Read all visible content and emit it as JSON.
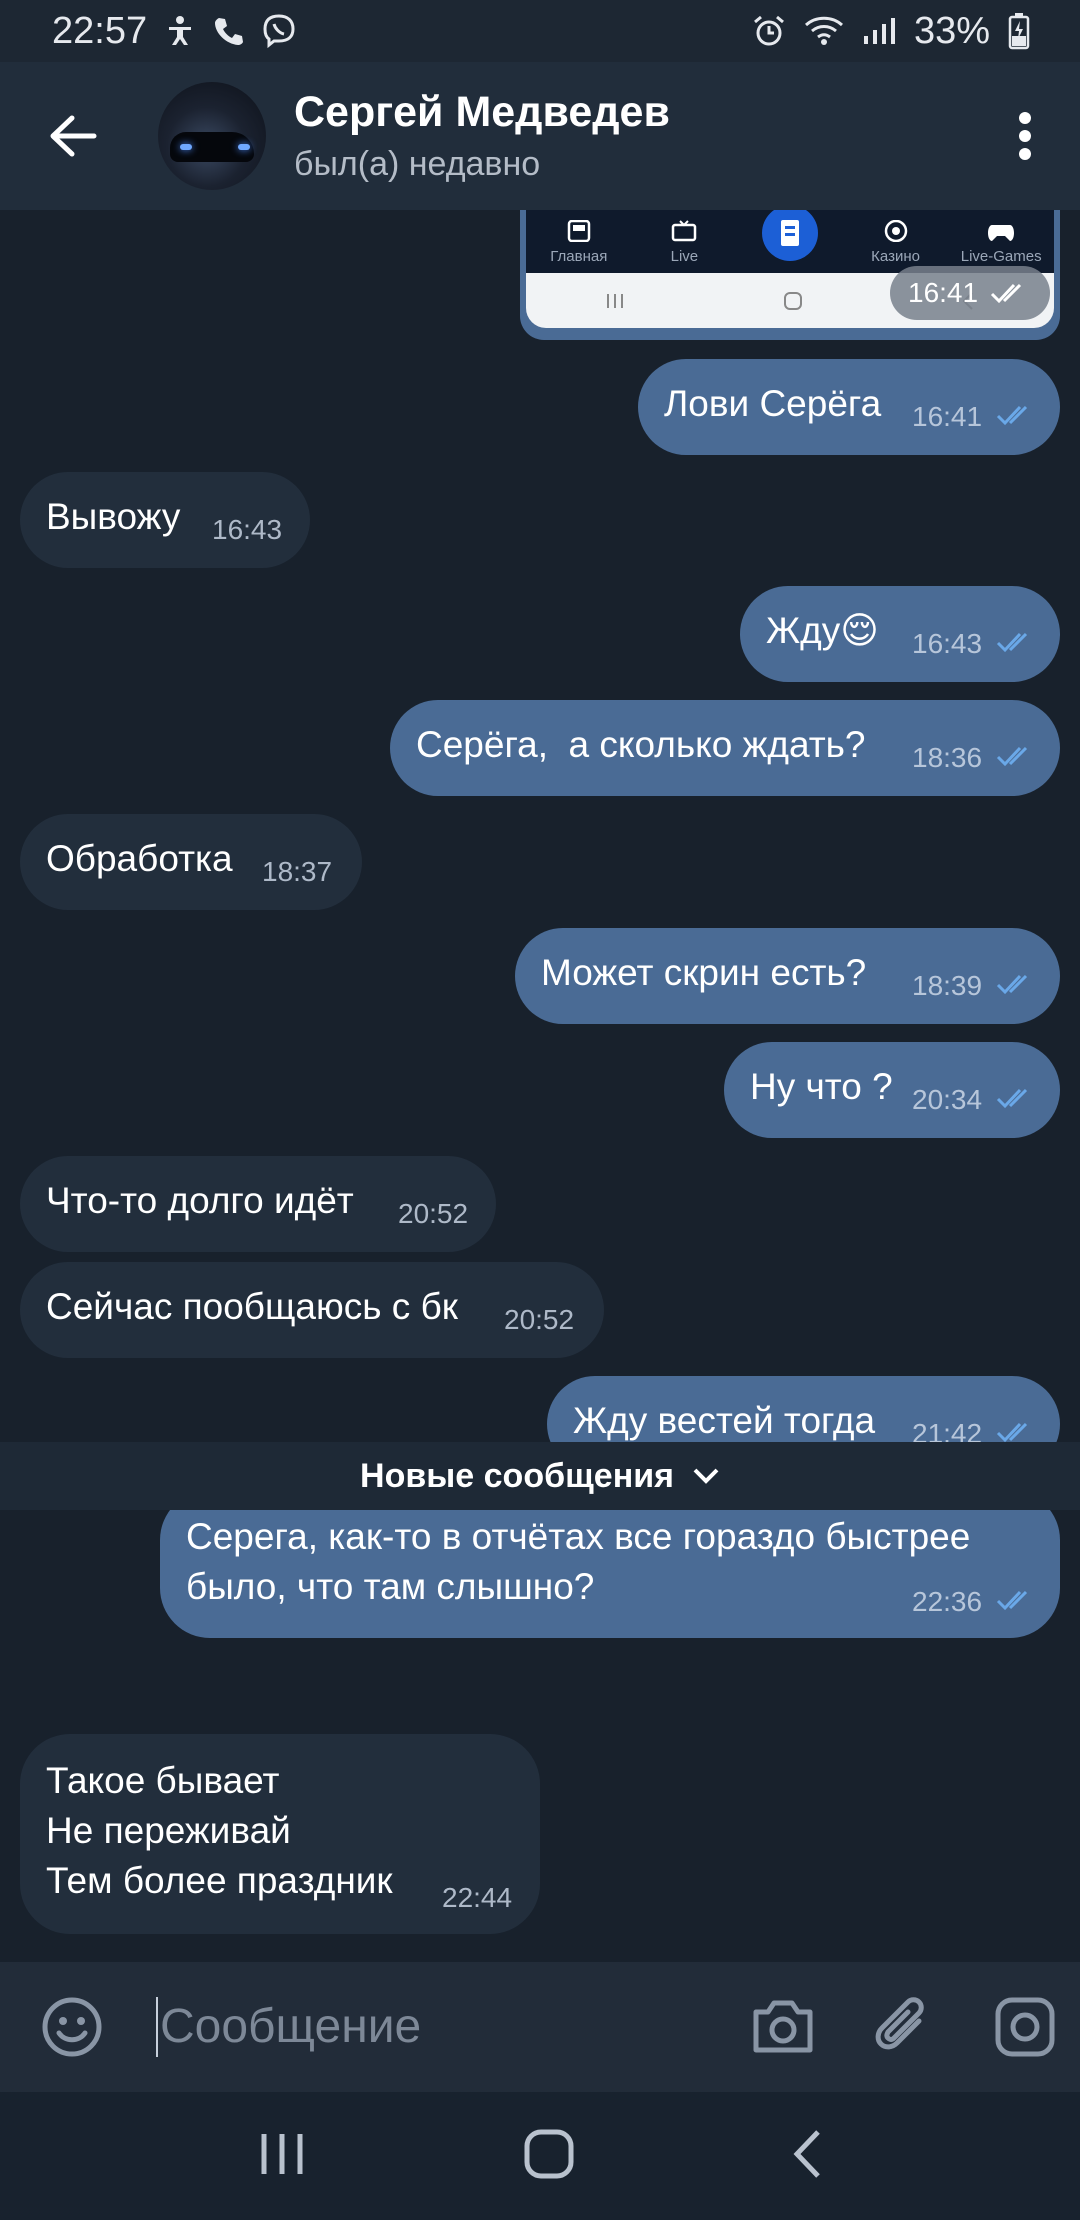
{
  "status_bar": {
    "time": "22:57",
    "battery": "33%"
  },
  "header": {
    "name": "Сергей Медведев",
    "status": "был(а) недавно"
  },
  "preview": {
    "nav_labels": [
      "Главная",
      "Live",
      "",
      "Казино",
      "Live-Games"
    ],
    "time": "16:41"
  },
  "messages": [
    {
      "dir": "out",
      "text": "Лови Серёга",
      "time": "16:41"
    },
    {
      "dir": "in",
      "text": "Вывожу",
      "time": "16:43"
    },
    {
      "dir": "out",
      "text": "Жду😌",
      "time": "16:43"
    },
    {
      "dir": "out",
      "text": "Серёга,  а сколько ждать?",
      "time": "18:36"
    },
    {
      "dir": "in",
      "text": "Обработка",
      "time": "18:37"
    },
    {
      "dir": "out",
      "text": "Может скрин есть?",
      "time": "18:39"
    },
    {
      "dir": "out",
      "text": "Ну что ?",
      "time": "20:34"
    },
    {
      "dir": "in",
      "text": "Что-то долго идёт",
      "time": "20:52"
    },
    {
      "dir": "in",
      "text": "Сейчас пообщаюсь с бк",
      "time": "20:52"
    },
    {
      "dir": "out",
      "text": "Жду вестей тогда",
      "time": "21:42"
    },
    {
      "dir": "out",
      "text": "Серега, как-то в отчётах все гораздо быстрее\nбыло, что там слышно?",
      "time": "22:36"
    },
    {
      "dir": "in",
      "text": "Такое бывает\nНе переживай\nТем более праздник",
      "time": "22:44"
    }
  ],
  "new_messages_label": "Новые сообщения",
  "input": {
    "placeholder": "Сообщение"
  },
  "colors": {
    "outgoing_bubble": "#4a6b95",
    "incoming_bubble": "#222e3c",
    "background": "#18212c",
    "check_read": "#6aa8e8"
  }
}
